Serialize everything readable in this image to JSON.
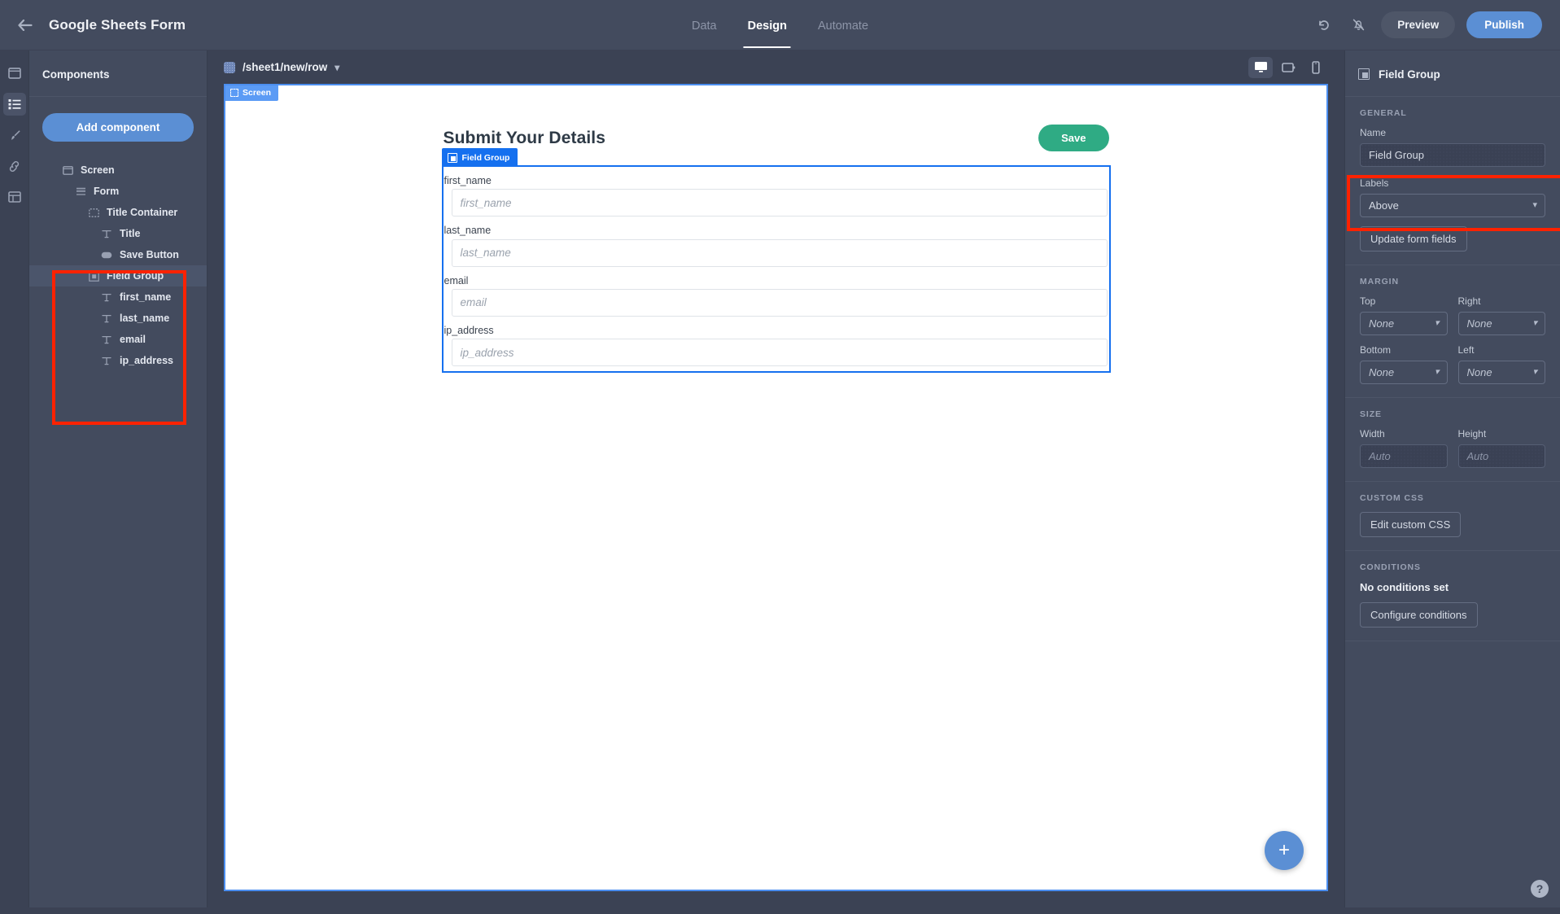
{
  "topbar": {
    "back_icon": "arrow-left-icon",
    "app_title": "Google Sheets Form",
    "tabs": [
      {
        "label": "Data",
        "active": false
      },
      {
        "label": "Design",
        "active": true
      },
      {
        "label": "Automate",
        "active": false
      }
    ],
    "undo_icon": "undo-icon",
    "mute_icon": "bell-off-icon",
    "preview_label": "Preview",
    "publish_label": "Publish"
  },
  "rail": {
    "items": [
      {
        "name": "screens-icon",
        "active": false
      },
      {
        "name": "components-list-icon",
        "active": true
      },
      {
        "name": "paintbrush-icon",
        "active": false
      },
      {
        "name": "link-icon",
        "active": false
      },
      {
        "name": "table-icon",
        "active": false
      }
    ]
  },
  "components_panel": {
    "title": "Components",
    "add_button_label": "Add component",
    "tree": [
      {
        "label": "Screen",
        "depth": 0,
        "icon": "screen-icon",
        "selected": false
      },
      {
        "label": "Form",
        "depth": 1,
        "icon": "form-icon",
        "selected": false
      },
      {
        "label": "Title Container",
        "depth": 2,
        "icon": "container-icon",
        "selected": false
      },
      {
        "label": "Title",
        "depth": 3,
        "icon": "text-icon",
        "selected": false
      },
      {
        "label": "Save Button",
        "depth": 3,
        "icon": "button-icon",
        "selected": false
      },
      {
        "label": "Field Group",
        "depth": 2,
        "icon": "field-group-icon",
        "selected": true
      },
      {
        "label": "first_name",
        "depth": 3,
        "icon": "text-icon",
        "selected": false
      },
      {
        "label": "last_name",
        "depth": 3,
        "icon": "text-icon",
        "selected": false
      },
      {
        "label": "email",
        "depth": 3,
        "icon": "text-icon",
        "selected": false
      },
      {
        "label": "ip_address",
        "depth": 3,
        "icon": "text-icon",
        "selected": false
      }
    ]
  },
  "canvas_bar": {
    "route": "/sheet1/new/row",
    "route_chevron": "chevron-down-icon",
    "devices": [
      {
        "name": "desktop-icon",
        "active": true
      },
      {
        "name": "tablet-icon",
        "active": false
      },
      {
        "name": "mobile-icon",
        "active": false
      }
    ]
  },
  "canvas": {
    "screen_badge": "Screen",
    "form": {
      "title": "Submit Your Details",
      "save_label": "Save",
      "field_group_badge": "Field Group",
      "fields": [
        {
          "label": "first_name",
          "placeholder": "first_name",
          "value": ""
        },
        {
          "label": "last_name",
          "placeholder": "last_name",
          "value": ""
        },
        {
          "label": "email",
          "placeholder": "email",
          "value": ""
        },
        {
          "label": "ip_address",
          "placeholder": "ip_address",
          "value": ""
        }
      ]
    },
    "fab_label": "+"
  },
  "properties": {
    "header_title": "Field Group",
    "general": {
      "section_title": "GENERAL",
      "name_label": "Name",
      "name_value": "Field Group",
      "labels_label": "Labels",
      "labels_value": "Above",
      "update_button_label": "Update form fields"
    },
    "margin": {
      "section_title": "MARGIN",
      "top_label": "Top",
      "top_value": "None",
      "right_label": "Right",
      "right_value": "None",
      "bottom_label": "Bottom",
      "bottom_value": "None",
      "left_label": "Left",
      "left_value": "None"
    },
    "size": {
      "section_title": "SIZE",
      "width_label": "Width",
      "width_placeholder": "Auto",
      "height_label": "Height",
      "height_placeholder": "Auto"
    },
    "custom_css": {
      "section_title": "CUSTOM CSS",
      "edit_button_label": "Edit custom CSS"
    },
    "conditions": {
      "section_title": "CONDITIONS",
      "status_text": "No conditions set",
      "configure_button_label": "Configure conditions"
    }
  },
  "help": {
    "label": "?"
  },
  "colors": {
    "chrome_bg": "#434b5e",
    "app_bg": "#3b4254",
    "accent_blue": "#5b8fd4",
    "selection_blue": "#1570ef",
    "screen_badge_blue": "#5b9bf5",
    "save_green": "#2fab84",
    "annotation_red": "#ff2200"
  }
}
